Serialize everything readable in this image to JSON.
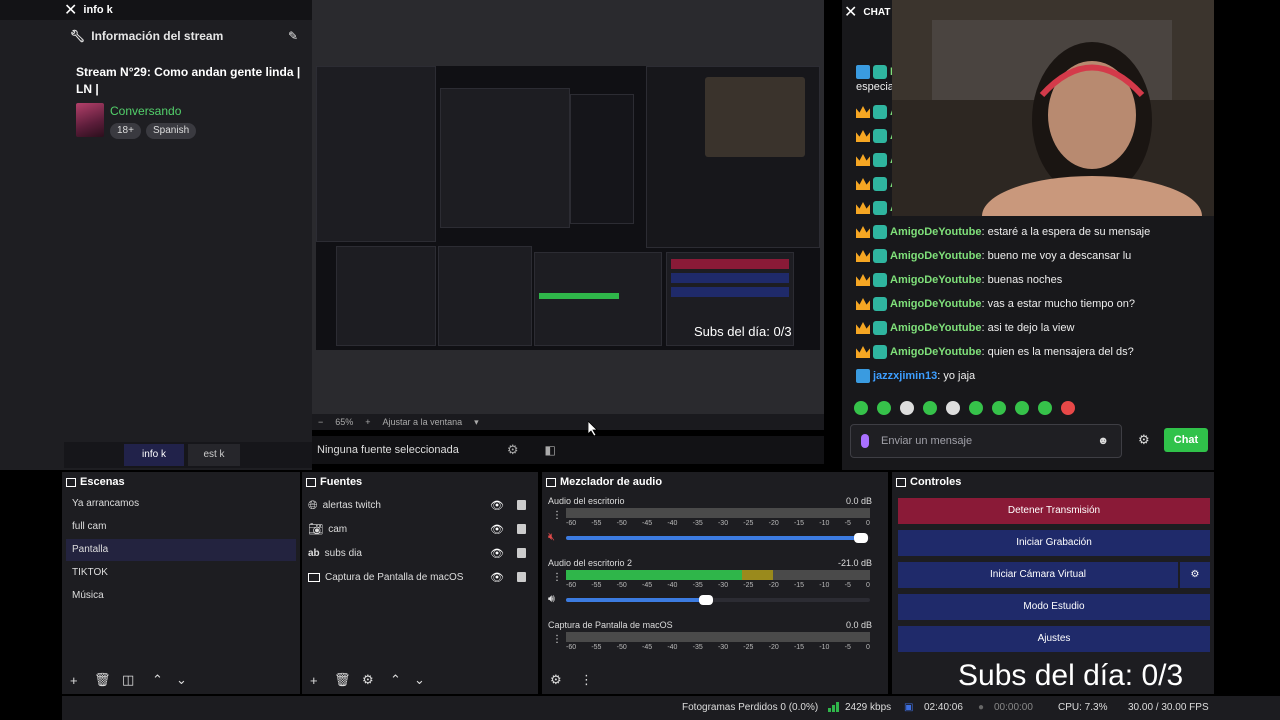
{
  "info_dock": {
    "title": "info k",
    "header": "Información del stream",
    "stream_title": "Stream N°29: Como andan gente linda | LN |",
    "category": "Conversando",
    "tags": [
      "18+",
      "Spanish"
    ],
    "tabs": [
      "info k",
      "est k"
    ]
  },
  "preview": {
    "zoom": "65%",
    "fit_label": "Ajustar a la ventana",
    "no_source": "Ninguna fuente seleccionada",
    "inner_overlay": "Subs del día: 0/3"
  },
  "chat": {
    "title": "CHAT",
    "partial_line_1": "especial",
    "messages": [
      {
        "user": "AmigoDeYoutube",
        "text": "estaré a la espera de su mensaje"
      },
      {
        "user": "AmigoDeYoutube",
        "text": "bueno me voy a descansar lu"
      },
      {
        "user": "AmigoDeYoutube",
        "text": "buenas noches"
      },
      {
        "user": "AmigoDeYoutube",
        "text": "vas a estar mucho tiempo on?"
      },
      {
        "user": "AmigoDeYoutube",
        "text": "asi te dejo la view"
      },
      {
        "user": "AmigoDeYoutube",
        "text": "quien es la mensajera del ds?"
      }
    ],
    "last_user": "jazzxjimin13",
    "last_text": "yo jaja",
    "input_placeholder": "Enviar un mensaje",
    "send_label": "Chat"
  },
  "scenes": {
    "title": "Escenas",
    "items": [
      "Ya arrancamos",
      "full cam",
      "Pantalla",
      "TIKTOK",
      "Música"
    ],
    "active_index": 2
  },
  "sources": {
    "title": "Fuentes",
    "items": [
      {
        "name": "alertas twitch",
        "icon": "browser-icon"
      },
      {
        "name": "cam",
        "icon": "camera-icon"
      },
      {
        "name": "subs dia",
        "icon": "text-icon"
      },
      {
        "name": "Captura de Pantalla de macOS",
        "icon": "monitor-icon"
      }
    ]
  },
  "mixer": {
    "title": "Mezclador de audio",
    "scale": [
      "-60",
      "-55",
      "-50",
      "-45",
      "-40",
      "-35",
      "-30",
      "-25",
      "-20",
      "-15",
      "-10",
      "-5",
      "0"
    ],
    "tracks": [
      {
        "name": "Audio del escritorio",
        "db": "0.0 dB",
        "level": 0,
        "volume": 0.97,
        "muted": true
      },
      {
        "name": "Audio del escritorio 2",
        "db": "-21.0 dB",
        "level": 0.68,
        "volume": 0.46,
        "muted": false
      },
      {
        "name": "Captura de Pantalla de macOS",
        "db": "0.0 dB",
        "level": 0,
        "volume": 0.97,
        "muted": true
      }
    ]
  },
  "controls": {
    "title": "Controles",
    "stop_stream": "Detener Transmisión",
    "start_recording": "Iniciar Grabación",
    "start_virtual_cam": "Iniciar Cámara Virtual",
    "studio_mode": "Modo Estudio",
    "settings": "Ajustes"
  },
  "overlay": {
    "subs_text": "Subs del día: 0/3"
  },
  "status": {
    "dropped_frames": "Fotogramas Perdidos 0 (0.0%)",
    "bitrate": "2429 kbps",
    "stream_time": "02:40:06",
    "rec_time": "00:00:00",
    "cpu": "CPU: 7.3%",
    "fps": "30.00 / 30.00 FPS"
  },
  "colors": {
    "stop_button": "#8a1a37",
    "control_button": "#1f2a6a",
    "chat_send": "#30c24a",
    "meter_green": "#2fb64a",
    "username_green": "#7fe07a"
  }
}
